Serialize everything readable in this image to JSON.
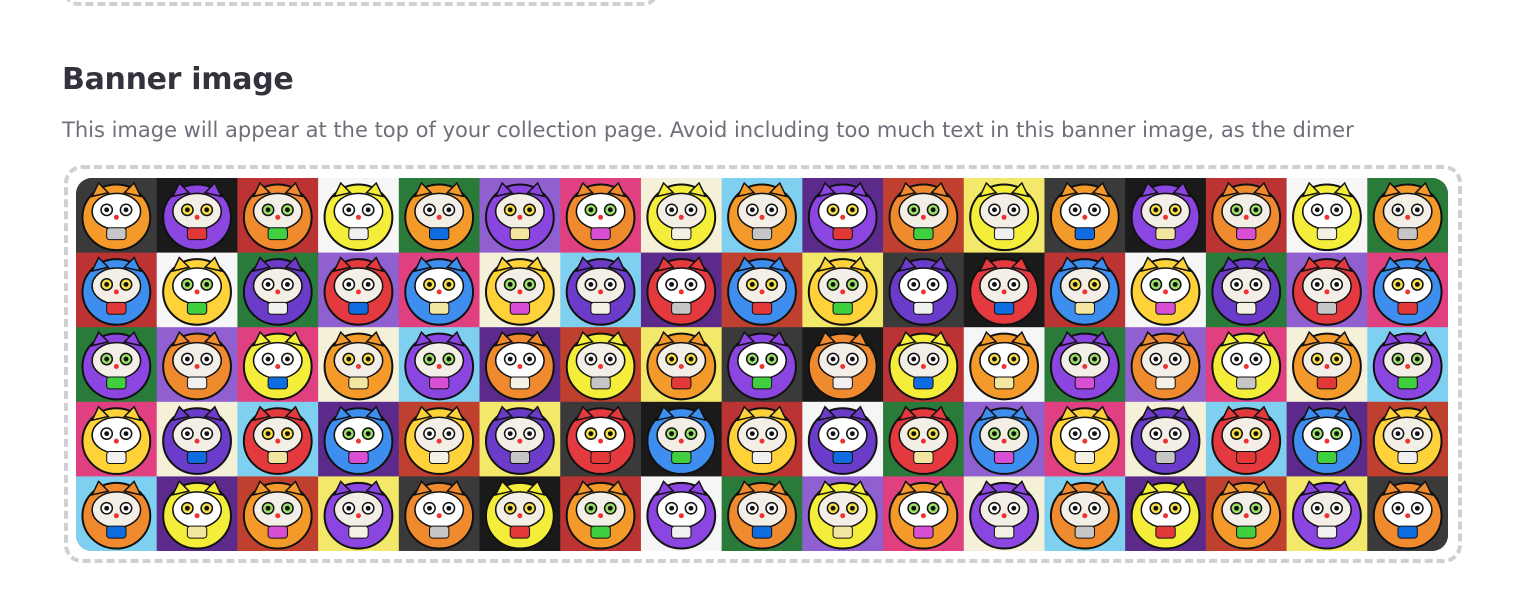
{
  "section": {
    "title": "Banner image",
    "description": "This image will appear at the top of your collection page. Avoid including too much text in this banner image, as the dimer"
  },
  "banner": {
    "alt": "Grid of colorful daruma cat illustrations",
    "rows": 5,
    "cols": 17,
    "palette": [
      "#f39a2b",
      "#e8323a",
      "#f2e6a0",
      "#6a3cc9",
      "#e64bc8",
      "#d84fd6",
      "#8b45e0",
      "#1c2fd6",
      "#f3f0e4",
      "#e43a3f",
      "#2f56d8",
      "#c6c6c6",
      "#f08a2e",
      "#f04fa0",
      "#e23838",
      "#3e8ef0",
      "#7a46d6",
      "#3fcf3f",
      "#f4ee3a",
      "#2a2a2a",
      "#f0f0f0",
      "#ffd23a",
      "#5ad04a",
      "#0f6be0"
    ]
  }
}
